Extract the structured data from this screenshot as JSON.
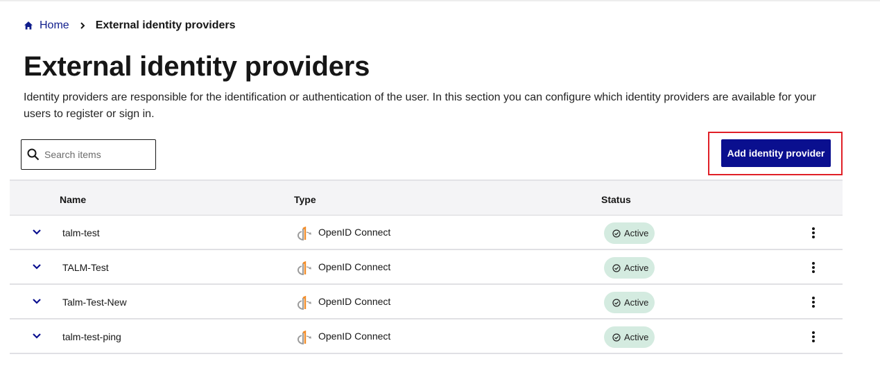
{
  "breadcrumb": {
    "home_label": "Home",
    "current_label": "External identity providers"
  },
  "page": {
    "title": "External identity providers",
    "description": "Identity providers are responsible for the identification or authentication of the user. In this section you can configure which identity providers are available for your users to register or sign in."
  },
  "search": {
    "placeholder": "Search items",
    "value": ""
  },
  "toolbar": {
    "add_label": "Add identity provider"
  },
  "table": {
    "columns": [
      "Name",
      "Type",
      "Status"
    ],
    "rows": [
      {
        "name": "talm-test",
        "type": "OpenID Connect",
        "type_icon": "openid-icon",
        "status": "Active"
      },
      {
        "name": "TALM-Test",
        "type": "OpenID Connect",
        "type_icon": "openid-icon",
        "status": "Active"
      },
      {
        "name": "Talm-Test-New",
        "type": "OpenID Connect",
        "type_icon": "openid-icon",
        "status": "Active"
      },
      {
        "name": "talm-test-ping",
        "type": "OpenID Connect",
        "type_icon": "openid-icon",
        "status": "Active"
      }
    ]
  },
  "colors": {
    "accent": "#0a0f8f",
    "link": "#0f1d8c",
    "status_active_bg": "#d4ebe0",
    "highlight": "#e01f26",
    "openid_orange": "#f28c28",
    "openid_gray": "#9a9a9a"
  },
  "icons": {
    "home": "home-icon",
    "separator": "chevron-right-icon",
    "search": "search-icon",
    "expand": "chevron-down-icon",
    "status": "check-circle-icon",
    "row_menu": "kebab-menu-icon"
  }
}
